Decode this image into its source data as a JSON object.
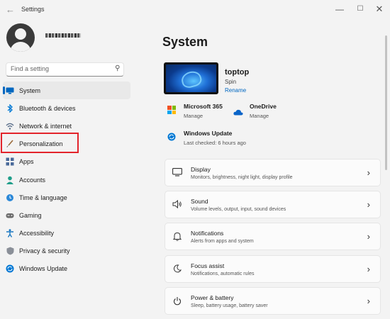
{
  "window": {
    "title": "Settings",
    "back_icon": "←",
    "min_icon": "—",
    "max_icon": "☐",
    "close_icon": "✕"
  },
  "profile": {
    "avatar": "user-avatar"
  },
  "search": {
    "placeholder": "Find a setting"
  },
  "nav": {
    "items": [
      {
        "label": "System",
        "icon": "monitor-icon",
        "active": true
      },
      {
        "label": "Bluetooth & devices",
        "icon": "bluetooth-icon"
      },
      {
        "label": "Network & internet",
        "icon": "wifi-icon"
      },
      {
        "label": "Personalization",
        "icon": "brush-icon",
        "highlighted": true
      },
      {
        "label": "Apps",
        "icon": "apps-icon"
      },
      {
        "label": "Accounts",
        "icon": "person-icon"
      },
      {
        "label": "Time & language",
        "icon": "globe-clock-icon"
      },
      {
        "label": "Gaming",
        "icon": "gamepad-icon"
      },
      {
        "label": "Accessibility",
        "icon": "accessibility-icon"
      },
      {
        "label": "Privacy & security",
        "icon": "shield-icon"
      },
      {
        "label": "Windows Update",
        "icon": "sync-icon"
      }
    ]
  },
  "main": {
    "title": "System",
    "device": {
      "name": "toptop",
      "model": "Spin",
      "rename": "Rename"
    },
    "tiles": {
      "m365": {
        "title": "Microsoft 365",
        "sub": "Manage"
      },
      "onedrive": {
        "title": "OneDrive",
        "sub": "Manage"
      },
      "update": {
        "title": "Windows Update",
        "sub": "Last checked: 6 hours ago"
      }
    },
    "cards": [
      {
        "title": "Display",
        "sub": "Monitors, brightness, night light, display profile",
        "icon": "display-icon"
      },
      {
        "title": "Sound",
        "sub": "Volume levels, output, input, sound devices",
        "icon": "speaker-icon"
      },
      {
        "title": "Notifications",
        "sub": "Alerts from apps and system",
        "icon": "bell-icon"
      },
      {
        "title": "Focus assist",
        "sub": "Notifications, automatic rules",
        "icon": "moon-icon"
      },
      {
        "title": "Power & battery",
        "sub": "Sleep, battery usage, battery saver",
        "icon": "power-icon"
      }
    ],
    "chevron": "›"
  },
  "colors": {
    "accent": "#0067c0",
    "highlight_box": "#e3242b",
    "background": "#f3f3f3"
  }
}
